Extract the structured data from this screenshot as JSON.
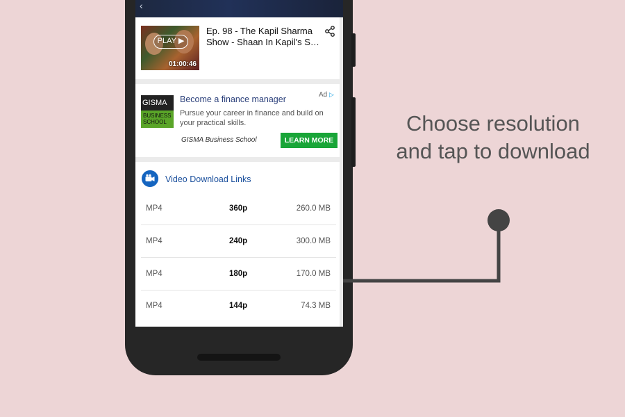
{
  "video": {
    "play_label": "PLAY ▶",
    "duration": "01:00:46",
    "title": "Ep. 98 - The Kapil Sharma Show - Shaan In Kapil's S…"
  },
  "ad": {
    "badge": "Ad",
    "logo_top": "GISMA",
    "logo_bottom": "BUSINESS SCHOOL",
    "title": "Become a finance manager",
    "description": "Pursue your career in finance and build on your practical skills.",
    "sponsor": "GISMA Business School",
    "cta_label": "LEARN MORE"
  },
  "downloads": {
    "title": "Video Download Links",
    "rows": [
      {
        "format": "MP4",
        "resolution": "360p",
        "size": "260.0 MB"
      },
      {
        "format": "MP4",
        "resolution": "240p",
        "size": "300.0 MB"
      },
      {
        "format": "MP4",
        "resolution": "180p",
        "size": "170.0 MB"
      },
      {
        "format": "MP4",
        "resolution": "144p",
        "size": "74.3 MB"
      }
    ]
  },
  "annotation": {
    "caption": "Choose resolution and tap to download"
  },
  "colors": {
    "background": "#edd5d6",
    "accent_blue": "#1565c0",
    "cta_green": "#19a538"
  }
}
